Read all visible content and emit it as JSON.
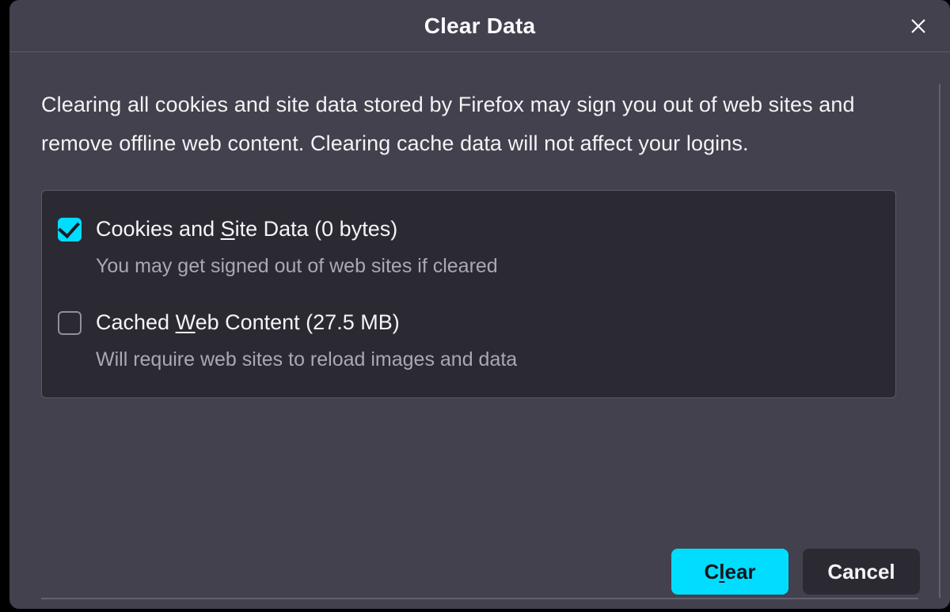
{
  "title": "Clear Data",
  "description": "Clearing all cookies and site data stored by Firefox may sign you out of web sites and remove offline web content. Clearing cache data will not affect your logins.",
  "options": [
    {
      "checked": true,
      "label_pre": "Cookies and ",
      "accesskey": "S",
      "label_post": "ite Data (0 bytes)",
      "sub": "You may get signed out of web sites if cleared"
    },
    {
      "checked": false,
      "label_pre": "Cached ",
      "accesskey": "W",
      "label_post": "eb Content (27.5 MB)",
      "sub": "Will require web sites to reload images and data"
    }
  ],
  "buttons": {
    "clear_pre": "C",
    "clear_accesskey": "l",
    "clear_post": "ear",
    "cancel": "Cancel"
  },
  "colors": {
    "accent": "#00ddff",
    "dialog_bg": "#42414d",
    "panel_bg": "#2b2a33"
  }
}
